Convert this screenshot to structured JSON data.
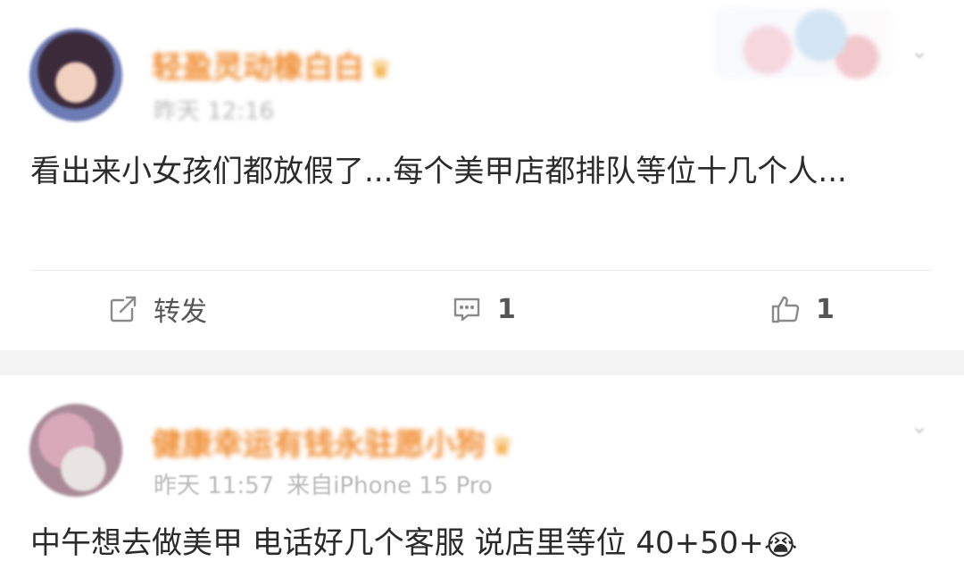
{
  "posts": [
    {
      "username": "轻盈灵动橡白白",
      "time": "昨天 12:16",
      "content": "看出来小女孩们都放假了...每个美甲店都排队等位十几个人...",
      "actions": {
        "repost_label": "转发",
        "comment_count": "1",
        "like_count": "1"
      }
    },
    {
      "username": "健康幸运有钱永驻愿小狗",
      "time": "昨天 11:57",
      "source": "来自iPhone 15 Pro",
      "content": "中午想去做美甲 电话好几个客服 说店里等位 40+50+",
      "emoji": "😭"
    }
  ],
  "icons": {
    "repost": "repost-icon",
    "comment": "comment-icon",
    "like": "like-icon",
    "more": "chevron-down-icon",
    "vip": "crown-icon"
  },
  "colors": {
    "username": "#f08a2c",
    "meta": "#b9b9b9",
    "text": "#2b2b2b",
    "separator": "#f3f3f3"
  }
}
